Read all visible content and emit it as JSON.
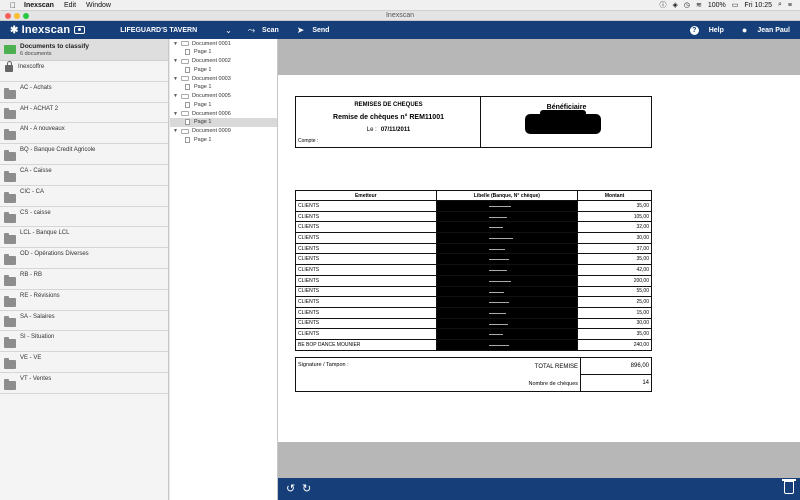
{
  "menubar": {
    "app_name": "Inexscan",
    "menus": [
      "Edit",
      "Window"
    ],
    "battery": "100%",
    "clock": "Fri 10:25"
  },
  "window": {
    "title": "Inexscan"
  },
  "toolbar": {
    "logo_text": "Inexscan",
    "company": "LIFEGUARD'S TAVERN",
    "scan_label": "Scan",
    "send_label": "Send",
    "help_label": "Help",
    "user_name": "Jean Paul"
  },
  "sidebar": {
    "classify_title": "Documents to classify",
    "classify_count": "6 documents",
    "vault_label": "Inexcoffre",
    "items": [
      "AC  -  Achats",
      "AH  -  ACHAT 2",
      "AN  -  A nouveaux",
      "BQ  -  Banque Credit Agricole",
      "CA  -  Caisse",
      "CIC  -  CA",
      "CS  -  caisse",
      "LCL  -  Banque LCL",
      "OD  -  Opérations Diverses",
      "RB  -  RB",
      "RE  -  Révisions",
      "SA  -  Salaires",
      "SI  -  Situation",
      "VE  -  VE",
      "VT  -  Ventes"
    ]
  },
  "tree": {
    "documents": [
      {
        "name": "Document 0001",
        "page": "Page 1"
      },
      {
        "name": "Document 0002",
        "page": "Page 1"
      },
      {
        "name": "Document 0003",
        "page": "Page 1"
      },
      {
        "name": "Document 0005",
        "page": "Page 1"
      },
      {
        "name": "Document 0006",
        "page": "Page 1"
      },
      {
        "name": "Document 0009",
        "page": "Page 1"
      }
    ]
  },
  "document": {
    "title": "REMISES DE CHEQUES",
    "remise": "Remise de chèques n° REM11001",
    "date_label": "Le :",
    "date": "07/11/2011",
    "compte_label": "Compte :",
    "beneficiaire": "Bénéficiaire",
    "headers": [
      "Emetteur",
      "Libelle (Banque, N° chèque)",
      "Montant"
    ],
    "rows": [
      {
        "emetteur": "CLIENTS",
        "montant": "35,00"
      },
      {
        "emetteur": "CLIENTS",
        "montant": "105,00"
      },
      {
        "emetteur": "CLIENTS",
        "montant": "32,00"
      },
      {
        "emetteur": "CLIENTS",
        "montant": "30,00"
      },
      {
        "emetteur": "CLIENTS",
        "montant": "37,00"
      },
      {
        "emetteur": "CLIENTS",
        "montant": "35,00"
      },
      {
        "emetteur": "CLIENTS",
        "montant": "42,00"
      },
      {
        "emetteur": "CLIENTS",
        "montant": "200,00"
      },
      {
        "emetteur": "CLIENTS",
        "montant": "55,00"
      },
      {
        "emetteur": "CLIENTS",
        "montant": "25,00"
      },
      {
        "emetteur": "CLIENTS",
        "montant": "15,00"
      },
      {
        "emetteur": "CLIENTS",
        "montant": "30,00"
      },
      {
        "emetteur": "CLIENTS",
        "montant": "35,00"
      },
      {
        "emetteur": "BE BOP DANCE MOUNIER",
        "montant": "240,00"
      }
    ],
    "signature_label": "Signature / Tampon :",
    "total_label": "TOTAL REMISE",
    "total_value": "896,00",
    "count_label": "Nombre de chèques",
    "count_value": "14"
  },
  "colors": {
    "accent": "#163f7a",
    "classify_green": "#4caf50"
  }
}
